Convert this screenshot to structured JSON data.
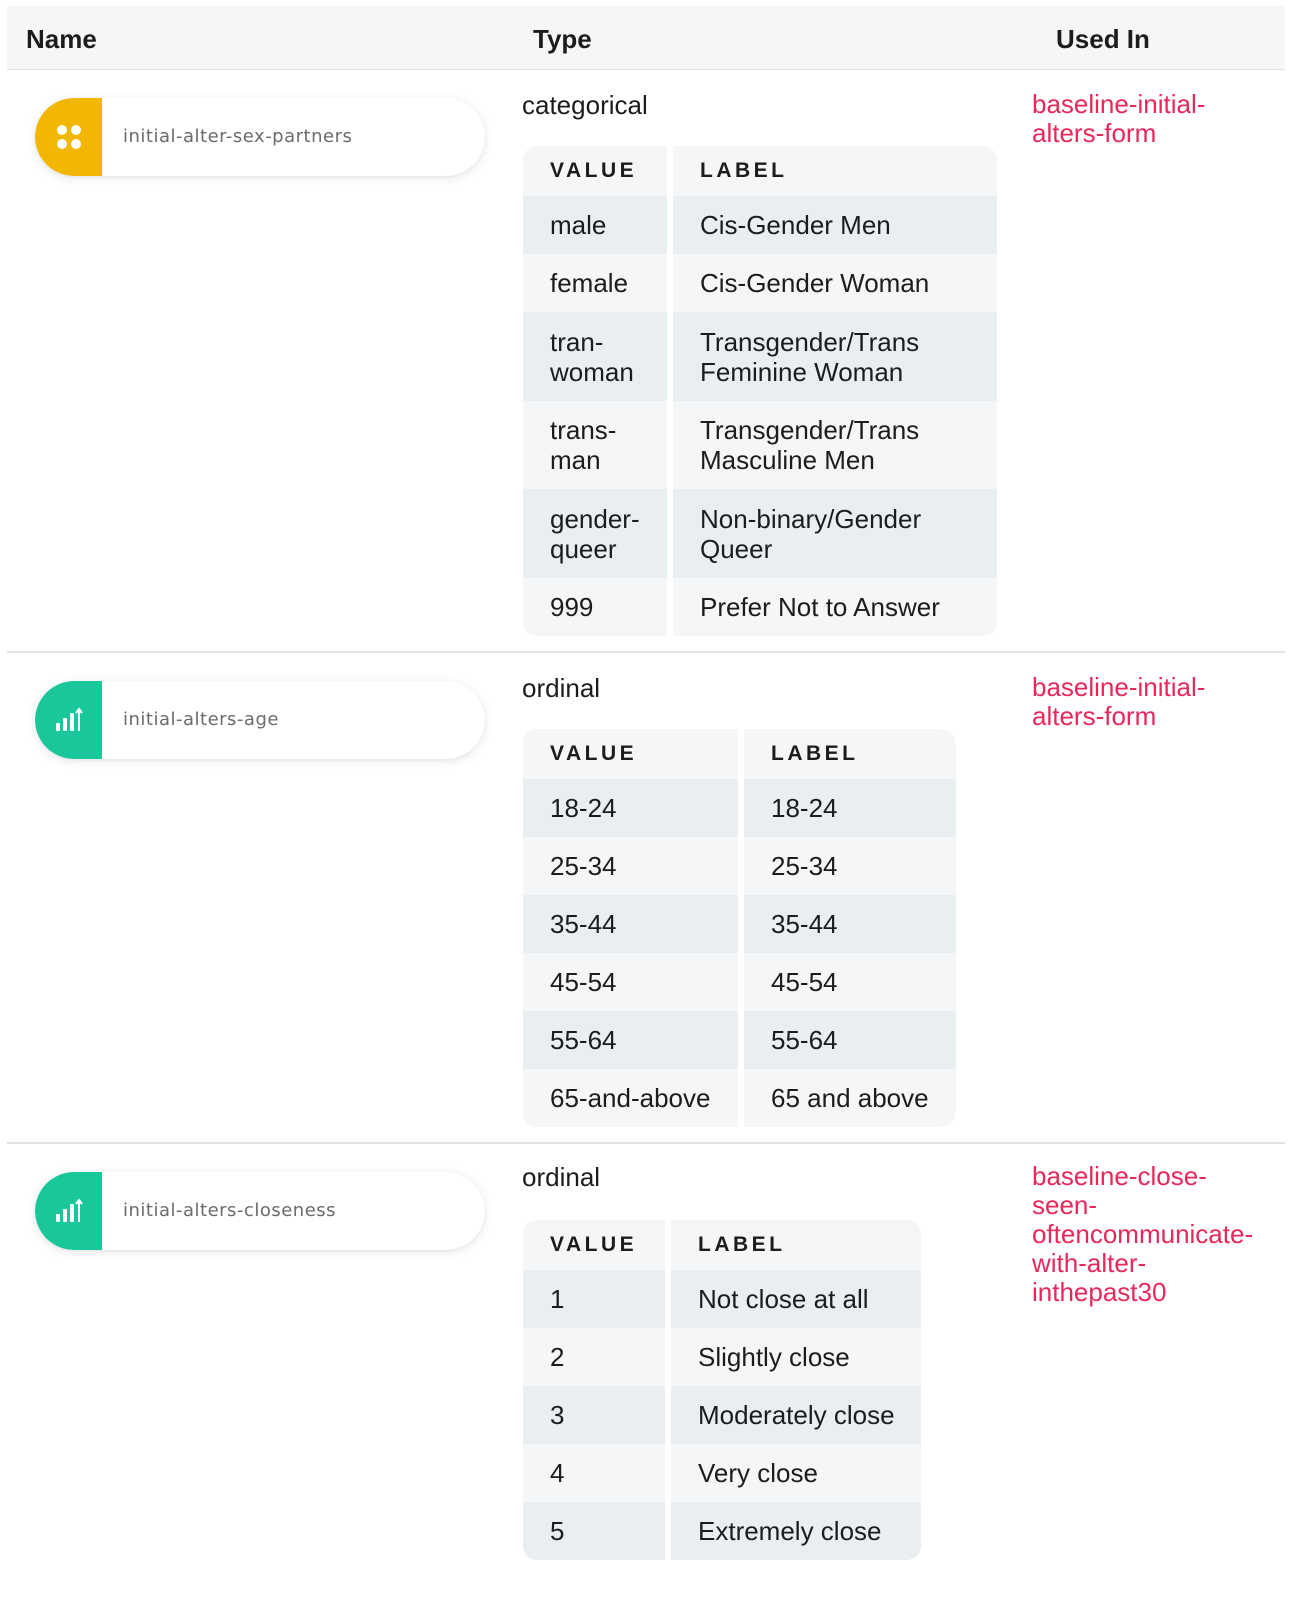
{
  "header": {
    "name": "Name",
    "type": "Type",
    "used_in": "Used In"
  },
  "variables": [
    {
      "name": "initial-alter-sex-partners",
      "icon": "dots-grid-icon",
      "badge_color": "#f2b705",
      "type": "categorical",
      "columns": {
        "value": "VALUE",
        "label": "LABEL"
      },
      "rows": [
        {
          "value": "male",
          "label": "Cis-Gender Men"
        },
        {
          "value": "female",
          "label": "Cis-Gender Woman"
        },
        {
          "value": "tran-\nwoman",
          "label": "Transgender/Trans\nFeminine Woman"
        },
        {
          "value": "trans-\nman",
          "label": "Transgender/Trans\nMasculine Men"
        },
        {
          "value": "gender-\nqueer",
          "label": "Non-binary/Gender\nQueer"
        },
        {
          "value": "999",
          "label": "Prefer Not to Answer"
        }
      ],
      "used_in": "baseline-initial-\nalters-form"
    },
    {
      "name": "initial-alters-age",
      "icon": "ordinal-bars-icon",
      "badge_color": "#19c79a",
      "type": "ordinal",
      "columns": {
        "value": "VALUE",
        "label": "LABEL"
      },
      "rows": [
        {
          "value": "18-24",
          "label": "18-24"
        },
        {
          "value": "25-34",
          "label": "25-34"
        },
        {
          "value": "35-44",
          "label": "35-44"
        },
        {
          "value": "45-54",
          "label": "45-54"
        },
        {
          "value": "55-64",
          "label": "55-64"
        },
        {
          "value": "65-and-above",
          "label": "65 and above"
        }
      ],
      "used_in": "baseline-initial-\nalters-form"
    },
    {
      "name": "initial-alters-closeness",
      "icon": "ordinal-bars-icon",
      "badge_color": "#19c79a",
      "type": "ordinal",
      "columns": {
        "value": "VALUE",
        "label": "LABEL"
      },
      "rows": [
        {
          "value": "1",
          "label": "Not close at all"
        },
        {
          "value": "2",
          "label": "Slightly close"
        },
        {
          "value": "3",
          "label": "Moderately close"
        },
        {
          "value": "4",
          "label": "Very close"
        },
        {
          "value": "5",
          "label": "Extremely close"
        }
      ],
      "used_in": "baseline-close-\nseen-\noftencommunicate-\nwith-alter-\ninthepast30"
    }
  ]
}
